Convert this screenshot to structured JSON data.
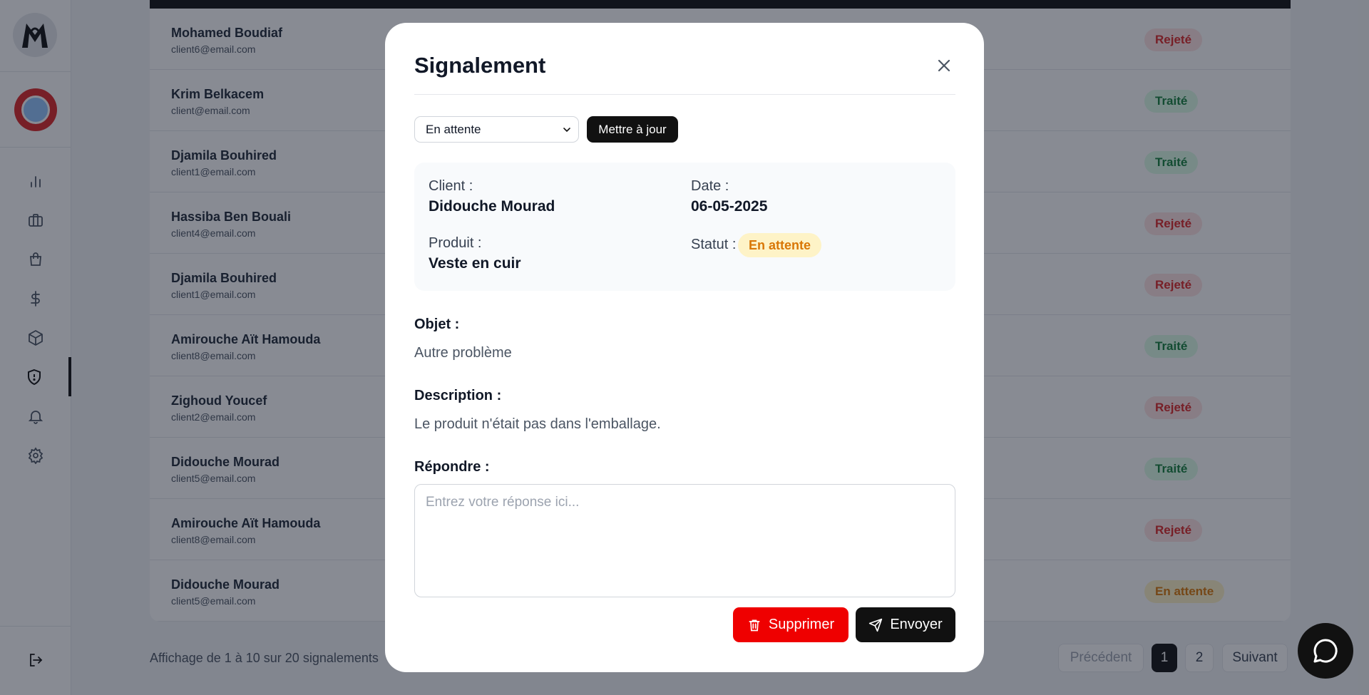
{
  "sidebar": {
    "nav": [
      {
        "name": "nav-dashboard",
        "icon": "bar-chart-icon"
      },
      {
        "name": "nav-briefcase",
        "icon": "briefcase-icon"
      },
      {
        "name": "nav-orders",
        "icon": "shopping-bag-icon"
      },
      {
        "name": "nav-payments",
        "icon": "dollar-icon"
      },
      {
        "name": "nav-products",
        "icon": "box-icon"
      },
      {
        "name": "nav-reports",
        "icon": "shield-icon",
        "active": true
      },
      {
        "name": "nav-notifications",
        "icon": "bell-icon"
      },
      {
        "name": "nav-settings",
        "icon": "gear-icon"
      }
    ]
  },
  "table": {
    "rows": [
      {
        "name": "Mohamed Boudiaf",
        "email": "client6@email.com",
        "status": "Rejeté"
      },
      {
        "name": "Krim Belkacem",
        "email": "client@email.com",
        "status": "Traité"
      },
      {
        "name": "Djamila Bouhired",
        "email": "client1@email.com",
        "status": "Traité"
      },
      {
        "name": "Hassiba Ben Bouali",
        "email": "client4@email.com",
        "status": "Rejeté"
      },
      {
        "name": "Djamila Bouhired",
        "email": "client1@email.com",
        "status": "Rejeté"
      },
      {
        "name": "Amirouche Aït Hamouda",
        "email": "client8@email.com",
        "status": "Traité"
      },
      {
        "name": "Zighoud Youcef",
        "email": "client2@email.com",
        "status": "Rejeté"
      },
      {
        "name": "Didouche Mourad",
        "email": "client5@email.com",
        "status": "Traité"
      },
      {
        "name": "Amirouche Aït Hamouda",
        "email": "client8@email.com",
        "status": "Rejeté"
      },
      {
        "name": "Didouche Mourad",
        "email": "client5@email.com",
        "status": "En attente"
      }
    ],
    "footer_text": "Affichage de 1 à 10 sur 20 signalements",
    "pagination": {
      "previous": "Précédent",
      "pages": [
        "1",
        "2"
      ],
      "current_page": "1",
      "next": "Suivant"
    }
  },
  "status_colors": {
    "Rejeté": {
      "bg": "#fee2e2",
      "fg": "#dc2626"
    },
    "Traité": {
      "bg": "#dcfce7",
      "fg": "#15803d"
    },
    "En attente": {
      "bg": "#fef3c7",
      "fg": "#d97706"
    }
  },
  "modal": {
    "title": "Signalement",
    "status_select": {
      "selected": "En attente"
    },
    "update_button": "Mettre à jour",
    "client_label": "Client :",
    "client_value": "Didouche Mourad",
    "date_label": "Date :",
    "date_value": "06-05-2025",
    "product_label": "Produit :",
    "product_value": "Veste en cuir",
    "status_label": "Statut :",
    "status_value": "En attente",
    "object_label": "Objet :",
    "object_value": "Autre problème",
    "description_label": "Description :",
    "description_value": "Le produit n'était pas dans l'emballage.",
    "reply_label": "Répondre :",
    "reply_placeholder": "Entrez votre réponse ici...",
    "delete_button": "Supprimer",
    "send_button": "Envoyer"
  }
}
